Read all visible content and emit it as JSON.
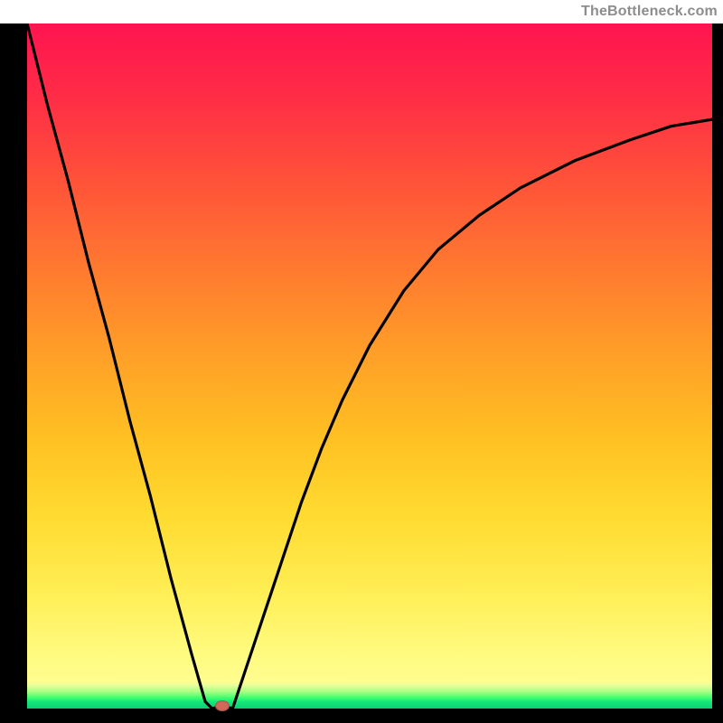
{
  "branding": {
    "watermark": "TheBottleneck.com"
  },
  "chart_data": {
    "type": "line",
    "title": "",
    "xlabel": "",
    "ylabel": "",
    "xlim": [
      0,
      100
    ],
    "ylim": [
      0,
      100
    ],
    "series": [
      {
        "name": "left-branch",
        "x": [
          0,
          3,
          6,
          9,
          12,
          15,
          18,
          21,
          24,
          26,
          27
        ],
        "values": [
          100,
          88,
          77,
          65,
          54,
          42,
          31,
          19,
          8,
          1,
          0
        ]
      },
      {
        "name": "notch",
        "x": [
          27,
          28.5,
          30
        ],
        "values": [
          0,
          0.4,
          0
        ]
      },
      {
        "name": "right-branch",
        "x": [
          30,
          32,
          34,
          36,
          38,
          40,
          43,
          46,
          50,
          55,
          60,
          66,
          72,
          80,
          88,
          94,
          100
        ],
        "values": [
          0,
          6,
          12,
          18,
          24,
          30,
          38,
          45,
          53,
          61,
          67,
          72,
          76,
          80,
          83,
          85,
          86
        ]
      }
    ],
    "annotations": [
      {
        "name": "minimum-dot",
        "x": 28.5,
        "y": 0.4
      }
    ],
    "background_gradient": {
      "top": "#ff1a4a",
      "mid_upper": "#ff6a2a",
      "mid": "#ffbf22",
      "mid_lower": "#ffee55",
      "bottom_band": "#14e77a"
    },
    "grid": false,
    "legend": false
  }
}
